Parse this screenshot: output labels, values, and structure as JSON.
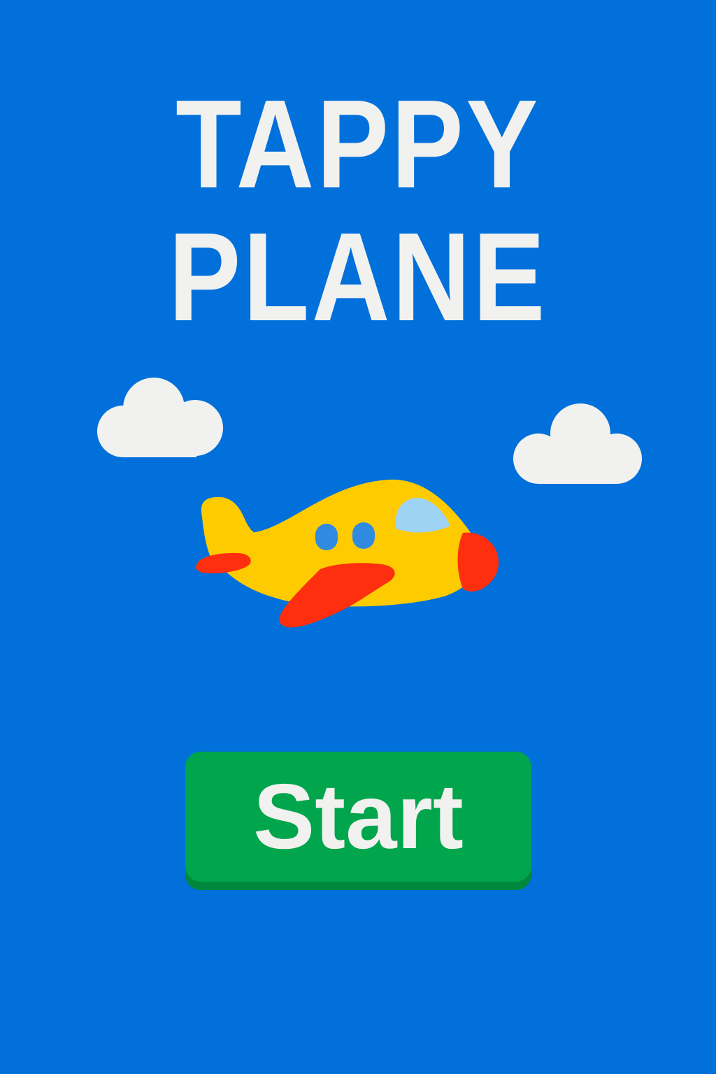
{
  "game": {
    "title_line1": "TAPPY",
    "title_line2": "PLANE",
    "start_label": "Start"
  },
  "colors": {
    "sky": "#0170db",
    "title_text": "#f1f1ef",
    "cloud": "#f1f1ef",
    "plane_body": "#fecb00",
    "plane_accent": "#fd2f0e",
    "plane_window": "#2f8ae0",
    "plane_cockpit": "#9fd3f3",
    "start_button": "#00a54c",
    "start_button_shadow": "#00873d"
  },
  "icons": {
    "plane": "airplane-icon",
    "cloud": "cloud-icon"
  }
}
